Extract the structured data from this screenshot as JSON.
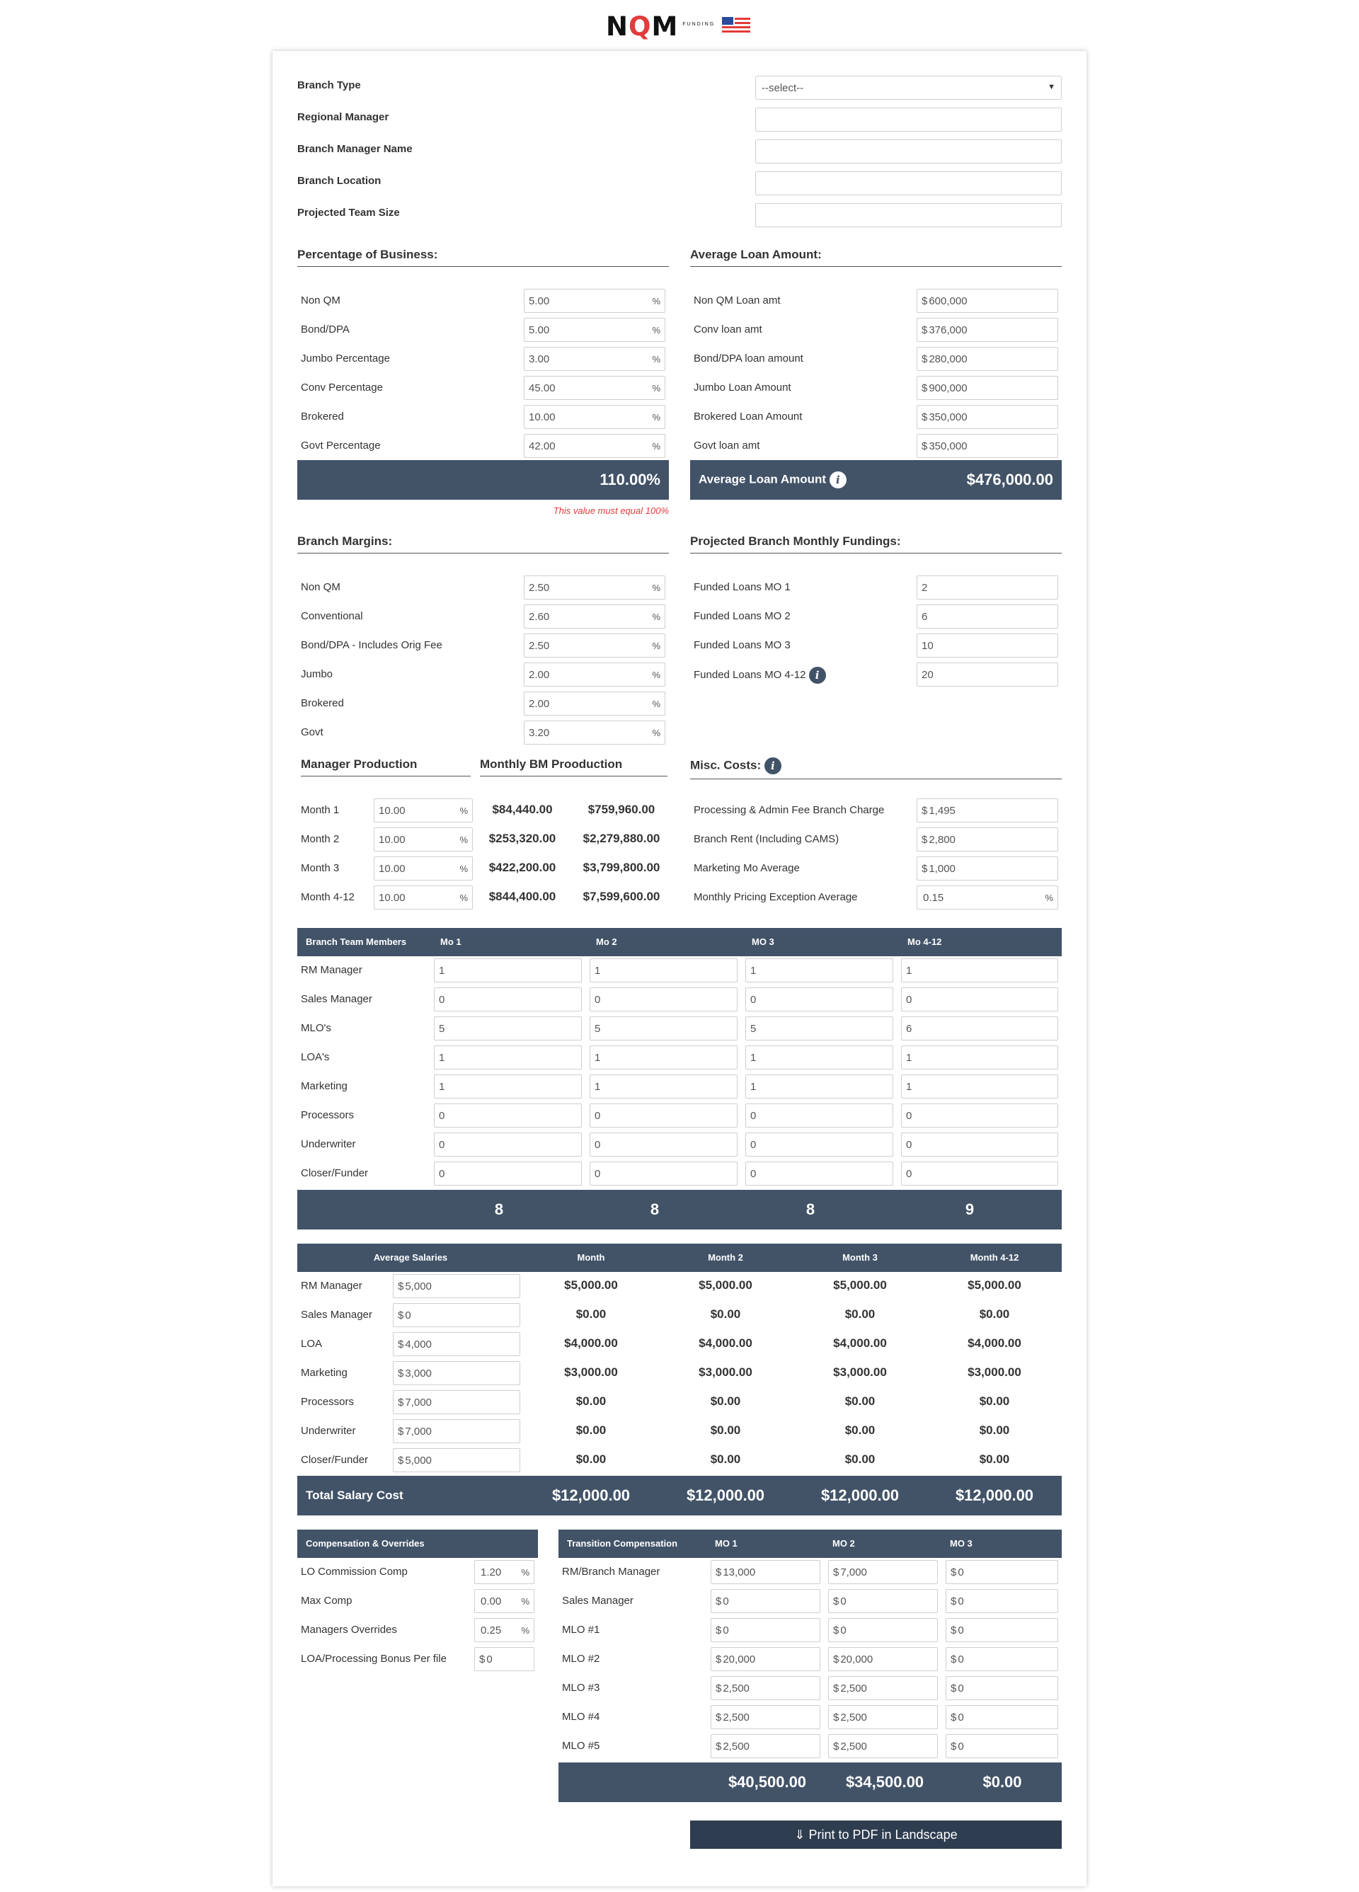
{
  "brand": {
    "logo_text_a": "N",
    "logo_text_q": "Q",
    "logo_text_b": "M",
    "logo_sub": "FUNDING"
  },
  "top_form": {
    "branch_type": {
      "label": "Branch Type",
      "value": "--select--"
    },
    "regional_manager": {
      "label": "Regional Manager",
      "value": ""
    },
    "branch_manager_name": {
      "label": "Branch Manager Name",
      "value": ""
    },
    "branch_location": {
      "label": "Branch Location",
      "value": ""
    },
    "projected_team_size": {
      "label": "Projected Team Size",
      "value": ""
    }
  },
  "pct_business": {
    "title": "Percentage of Business:",
    "rows": [
      {
        "label": "Non QM",
        "value": "5.00",
        "suffix": "%"
      },
      {
        "label": "Bond/DPA",
        "value": "5.00",
        "suffix": "%"
      },
      {
        "label": "Jumbo Percentage",
        "value": "3.00",
        "suffix": "%"
      },
      {
        "label": "Conv Percentage",
        "value": "45.00",
        "suffix": "%"
      },
      {
        "label": "Brokered",
        "value": "10.00",
        "suffix": "%"
      },
      {
        "label": "Govt Percentage",
        "value": "42.00",
        "suffix": "%"
      }
    ],
    "total": "110.00%",
    "error": "This value must equal 100%"
  },
  "avg_loan": {
    "title": "Average Loan Amount:",
    "rows": [
      {
        "label": "Non QM Loan amt",
        "prefix": "$",
        "value": "600,000"
      },
      {
        "label": "Conv loan amt",
        "prefix": "$",
        "value": "376,000"
      },
      {
        "label": "Bond/DPA loan amount",
        "prefix": "$",
        "value": "280,000"
      },
      {
        "label": "Jumbo Loan Amount",
        "prefix": "$",
        "value": "900,000"
      },
      {
        "label": "Brokered Loan Amount",
        "prefix": "$",
        "value": "350,000"
      },
      {
        "label": "Govt loan amt",
        "prefix": "$",
        "value": "350,000"
      }
    ],
    "total_label": "Average Loan Amount",
    "total": "$476,000.00"
  },
  "branch_margins": {
    "title": "Branch Margins:",
    "rows": [
      {
        "label": "Non QM",
        "value": "2.50",
        "suffix": "%"
      },
      {
        "label": "Conventional",
        "value": "2.60",
        "suffix": "%"
      },
      {
        "label": "Bond/DPA - Includes Orig Fee",
        "value": "2.50",
        "suffix": "%"
      },
      {
        "label": "Jumbo",
        "value": "2.00",
        "suffix": "%"
      },
      {
        "label": "Brokered",
        "value": "2.00",
        "suffix": "%"
      },
      {
        "label": "Govt",
        "value": "3.20",
        "suffix": "%"
      }
    ]
  },
  "fundings": {
    "title": "Projected Branch Monthly Fundings:",
    "rows": [
      {
        "label": "Funded Loans MO 1",
        "value": "2"
      },
      {
        "label": "Funded Loans MO 2",
        "value": "6"
      },
      {
        "label": "Funded Loans MO 3",
        "value": "10"
      },
      {
        "label": "Funded Loans MO 4-12",
        "value": "20"
      }
    ]
  },
  "manager_production": {
    "title": "Manager Production",
    "title2": "Monthly BM Prooduction",
    "rows": [
      {
        "label": "Month 1",
        "value": "10.00",
        "suffix": "%",
        "a": "$84,440.00",
        "b": "$759,960.00"
      },
      {
        "label": "Month 2",
        "value": "10.00",
        "suffix": "%",
        "a": "$253,320.00",
        "b": "$2,279,880.00"
      },
      {
        "label": "Month 3",
        "value": "10.00",
        "suffix": "%",
        "a": "$422,200.00",
        "b": "$3,799,800.00"
      },
      {
        "label": "Month 4-12",
        "value": "10.00",
        "suffix": "%",
        "a": "$844,400.00",
        "b": "$7,599,600.00"
      }
    ]
  },
  "misc": {
    "title": "Misc. Costs:",
    "rows": [
      {
        "label": "Processing & Admin Fee Branch Charge",
        "prefix": "$",
        "value": "1,495",
        "suffix": ""
      },
      {
        "label": "Branch Rent (Including CAMS)",
        "prefix": "$",
        "value": "2,800",
        "suffix": ""
      },
      {
        "label": "Marketing Mo Average",
        "prefix": "$",
        "value": "1,000",
        "suffix": ""
      },
      {
        "label": "Monthly Pricing Exception Average",
        "prefix": "",
        "value": "0.15",
        "suffix": "%"
      }
    ]
  },
  "team": {
    "headers": [
      "Branch Team Members",
      "Mo 1",
      "Mo 2",
      "MO 3",
      "Mo 4-12"
    ],
    "rows": [
      {
        "label": "RM Manager",
        "values": [
          "1",
          "1",
          "1",
          "1"
        ]
      },
      {
        "label": "Sales Manager",
        "values": [
          "0",
          "0",
          "0",
          "0"
        ]
      },
      {
        "label": "MLO's",
        "values": [
          "5",
          "5",
          "5",
          "6"
        ]
      },
      {
        "label": "LOA's",
        "values": [
          "1",
          "1",
          "1",
          "1"
        ]
      },
      {
        "label": "Marketing",
        "values": [
          "1",
          "1",
          "1",
          "1"
        ]
      },
      {
        "label": "Processors",
        "values": [
          "0",
          "0",
          "0",
          "0"
        ]
      },
      {
        "label": "Underwriter",
        "values": [
          "0",
          "0",
          "0",
          "0"
        ]
      },
      {
        "label": "Closer/Funder",
        "values": [
          "0",
          "0",
          "0",
          "0"
        ]
      }
    ],
    "totals": [
      "8",
      "8",
      "8",
      "9"
    ]
  },
  "salaries": {
    "headers": [
      "Average Salaries",
      "Month",
      "Month 2",
      "Month 3",
      "Month 4-12"
    ],
    "rows": [
      {
        "label": "RM Manager",
        "prefix": "$",
        "value": "5,000",
        "months": [
          "$5,000.00",
          "$5,000.00",
          "$5,000.00",
          "$5,000.00"
        ]
      },
      {
        "label": "Sales Manager",
        "prefix": "$",
        "value": "0",
        "months": [
          "$0.00",
          "$0.00",
          "$0.00",
          "$0.00"
        ]
      },
      {
        "label": "LOA",
        "prefix": "$",
        "value": "4,000",
        "months": [
          "$4,000.00",
          "$4,000.00",
          "$4,000.00",
          "$4,000.00"
        ]
      },
      {
        "label": "Marketing",
        "prefix": "$",
        "value": "3,000",
        "months": [
          "$3,000.00",
          "$3,000.00",
          "$3,000.00",
          "$3,000.00"
        ]
      },
      {
        "label": "Processors",
        "prefix": "$",
        "value": "7,000",
        "months": [
          "$0.00",
          "$0.00",
          "$0.00",
          "$0.00"
        ]
      },
      {
        "label": "Underwriter",
        "prefix": "$",
        "value": "7,000",
        "months": [
          "$0.00",
          "$0.00",
          "$0.00",
          "$0.00"
        ]
      },
      {
        "label": "Closer/Funder",
        "prefix": "$",
        "value": "5,000",
        "months": [
          "$0.00",
          "$0.00",
          "$0.00",
          "$0.00"
        ]
      }
    ],
    "total_label": "Total Salary Cost",
    "totals": [
      "$12,000.00",
      "$12,000.00",
      "$12,000.00",
      "$12,000.00"
    ]
  },
  "comp": {
    "header": "Compensation & Overrides",
    "rows": [
      {
        "label": "LO Commission Comp",
        "prefix": "",
        "value": "1.20",
        "suffix": "%"
      },
      {
        "label": "Max Comp",
        "prefix": "",
        "value": "0.00",
        "suffix": "%"
      },
      {
        "label": "Managers Overrides",
        "prefix": "",
        "value": "0.25",
        "suffix": "%"
      },
      {
        "label": "LOA/Processing Bonus Per file",
        "prefix": "$",
        "value": "0",
        "suffix": ""
      }
    ]
  },
  "transition": {
    "headers": [
      "Transition Compensation",
      "MO 1",
      "MO 2",
      "MO 3"
    ],
    "rows": [
      {
        "label": "RM/Branch Manager",
        "values": [
          "13,000",
          "7,000",
          "0"
        ]
      },
      {
        "label": "Sales Manager",
        "values": [
          "0",
          "0",
          "0"
        ]
      },
      {
        "label": "MLO #1",
        "values": [
          "0",
          "0",
          "0"
        ]
      },
      {
        "label": "MLO #2",
        "values": [
          "20,000",
          "20,000",
          "0"
        ]
      },
      {
        "label": "MLO #3",
        "values": [
          "2,500",
          "2,500",
          "0"
        ]
      },
      {
        "label": "MLO #4",
        "values": [
          "2,500",
          "2,500",
          "0"
        ]
      },
      {
        "label": "MLO #5",
        "values": [
          "2,500",
          "2,500",
          "0"
        ]
      }
    ],
    "prefix": "$",
    "totals": [
      "$40,500.00",
      "$34,500.00",
      "$0.00"
    ]
  },
  "print_button": "⇓ Print to PDF in Landscape",
  "colors": {
    "bar": "#425368",
    "button": "#2e3d4f",
    "error": "#e23b3b"
  }
}
